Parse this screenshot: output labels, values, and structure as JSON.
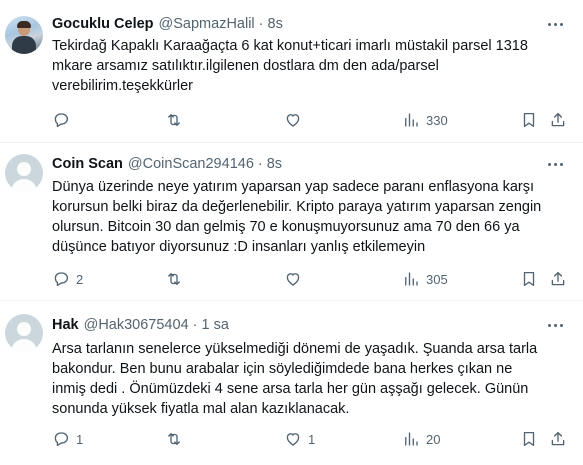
{
  "tweets": [
    {
      "name": "Gocuklu Celep",
      "handle": "@SapmazHalil",
      "separator": "·",
      "time": "8s",
      "avatar": "user-photo",
      "text": "Tekirdağ Kapaklı Karaağaçta 6 kat konut+ticari imarlı müstakil parsel 1318\nmkare arsamız satılıktır.ilgilenen dostlara dm den ada/parsel\nverebilirim.teşekkürler",
      "replies": "",
      "retweets": "",
      "likes": "",
      "views": "330"
    },
    {
      "name": "Coin Scan",
      "handle": "@CoinScan294146",
      "separator": "·",
      "time": "8s",
      "avatar": "default-avatar",
      "text": "Dünya üzerinde neye yatırım yaparsan yap sadece paranı enflasyona karşı\nkorursun belki biraz da değerlenebilir. Kripto paraya yatırım yaparsan zengin\nolursun. Bitcoin 30 dan gelmiş 70 e konuşmuyorsunuz ama 70 den 66 ya\ndüşünce batıyor diyorsunuz :D insanları yanlış etkilemeyin",
      "replies": "2",
      "retweets": "",
      "likes": "",
      "views": "305"
    },
    {
      "name": "Hak",
      "handle": "@Hak30675404",
      "separator": "·",
      "time": "1 sa",
      "avatar": "default-avatar",
      "text": "Arsa tarlanın senelerce yükselmediği dönemi de yaşadık. Şuanda arsa tarla\nbakondur. Ben bunu arabalar için söylediğimdede bana herkes çıkan ne\ninmiş dedi . Önümüzdeki 4 sene arsa tarla her gün aşşağı gelecek. Günün\nsonunda yüksek fiyatla mal alan kazıklanacak.",
      "replies": "1",
      "retweets": "",
      "likes": "1",
      "views": "20"
    }
  ],
  "icons": {
    "reply": "reply-icon",
    "retweet": "retweet-icon",
    "like": "like-icon",
    "views": "views-icon",
    "bookmark": "bookmark-icon",
    "share": "share-icon",
    "more": "more-icon"
  },
  "colors": {
    "text": "#0f1419",
    "secondary": "#536471",
    "divider": "#eff3f4",
    "default_avatar": "#ccd6dd"
  }
}
